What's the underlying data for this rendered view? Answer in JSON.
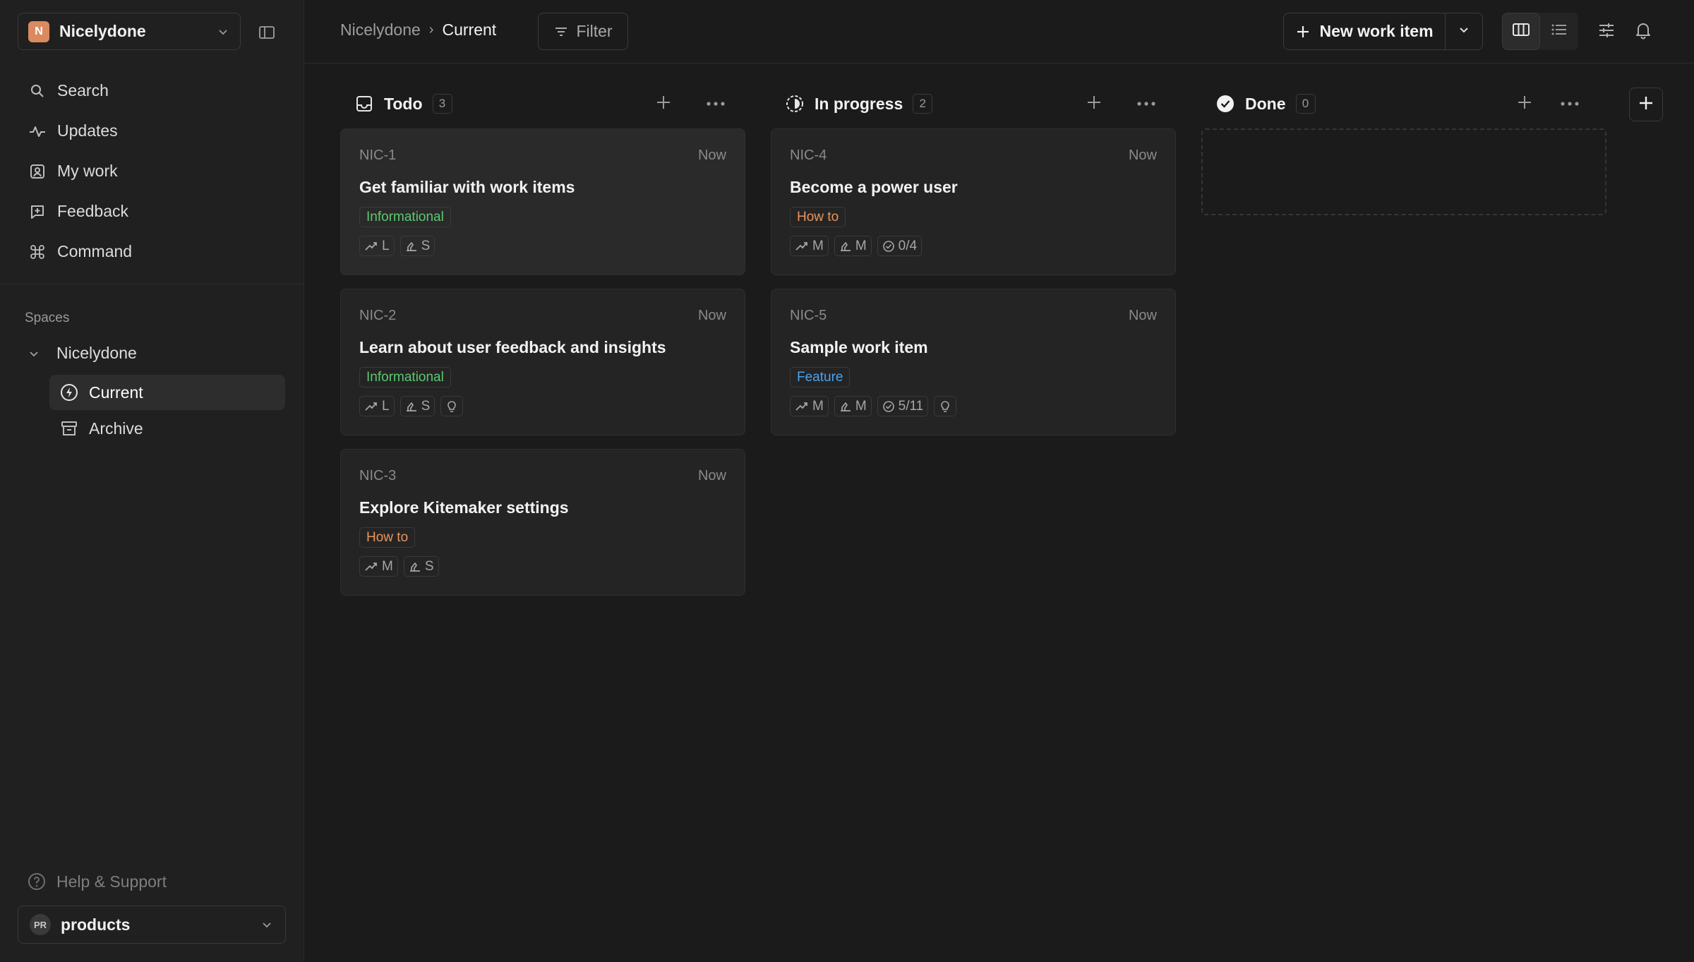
{
  "workspace": {
    "initial": "N",
    "name": "Nicelydone"
  },
  "nav": [
    {
      "label": "Search"
    },
    {
      "label": "Updates"
    },
    {
      "label": "My work"
    },
    {
      "label": "Feedback"
    },
    {
      "label": "Command"
    }
  ],
  "spaces": {
    "title": "Spaces",
    "root": "Nicelydone",
    "items": [
      {
        "label": "Current"
      },
      {
        "label": "Archive"
      }
    ]
  },
  "help_label": "Help & Support",
  "product": {
    "badge": "PR",
    "name": "products"
  },
  "breadcrumb": {
    "root": "Nicelydone",
    "separator": "›",
    "current": "Current"
  },
  "filter_label": "Filter",
  "new_item_label": "New work item",
  "columns": [
    {
      "title": "Todo",
      "count": "3",
      "cards": [
        {
          "id": "NIC-1",
          "time": "Now",
          "title": "Get familiar with work items",
          "label": "Informational",
          "label_color": "#5cc96f",
          "props": [
            "L",
            "S"
          ]
        },
        {
          "id": "NIC-2",
          "time": "Now",
          "title": "Learn about user feedback and insights",
          "label": "Informational",
          "label_color": "#5cc96f",
          "props": [
            "L",
            "S"
          ]
        },
        {
          "id": "NIC-3",
          "time": "Now",
          "title": "Explore Kitemaker settings",
          "label": "How to",
          "label_color": "#e8955c",
          "props": [
            "M",
            "S"
          ]
        }
      ]
    },
    {
      "title": "In progress",
      "count": "2",
      "cards": [
        {
          "id": "NIC-4",
          "time": "Now",
          "title": "Become a power user",
          "label": "How to",
          "label_color": "#e8955c",
          "props": [
            "M",
            "M"
          ],
          "todos": "0/4"
        },
        {
          "id": "NIC-5",
          "time": "Now",
          "title": "Sample work item",
          "label": "Feature",
          "label_color": "#4aa3f0",
          "props": [
            "M",
            "M"
          ],
          "todos": "5/11"
        }
      ]
    },
    {
      "title": "Done",
      "count": "0",
      "cards": []
    }
  ],
  "colors": {
    "background": "#1b1b1b",
    "sidebar": "#202020",
    "card": "#242424",
    "accent_orange": "#d98a5f"
  }
}
